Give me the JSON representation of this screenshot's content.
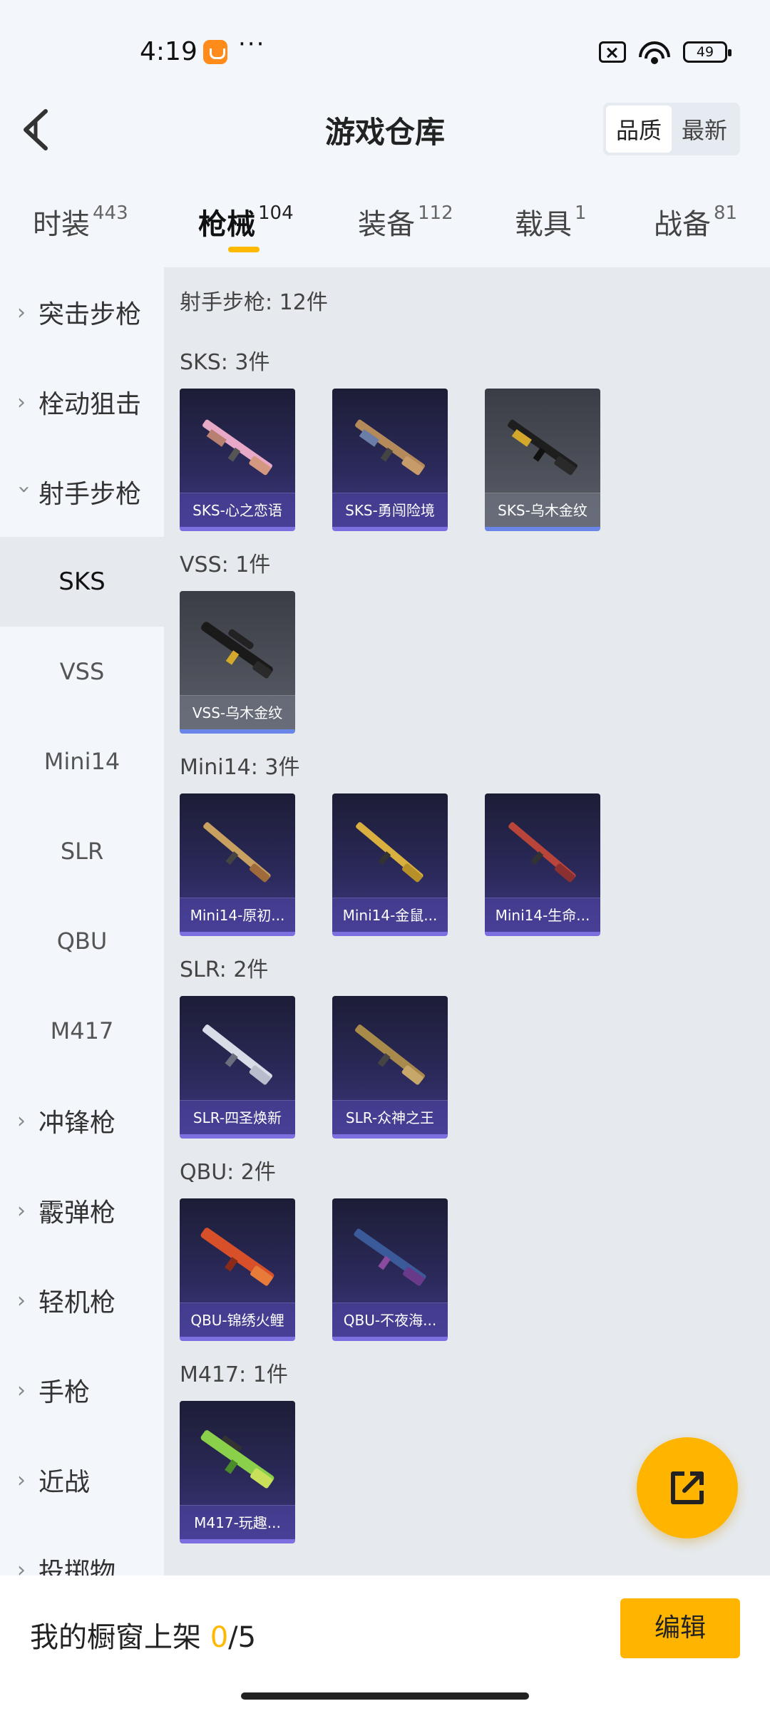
{
  "status_bar": {
    "time": "4:19",
    "dots": "···",
    "battery": "49"
  },
  "header": {
    "title": "游戏仓库",
    "sort_options": [
      "品质",
      "最新"
    ]
  },
  "tabs": [
    {
      "label": "时装",
      "count": "443"
    },
    {
      "label": "枪械",
      "count": "104"
    },
    {
      "label": "装备",
      "count": "112"
    },
    {
      "label": "载具",
      "count": "1"
    },
    {
      "label": "战备",
      "count": "81"
    }
  ],
  "sidebar": {
    "items": [
      {
        "label": "突击步枪",
        "expanded": false
      },
      {
        "label": "栓动狙击",
        "expanded": false
      },
      {
        "label": "射手步枪",
        "expanded": true
      },
      {
        "label": "SKS"
      },
      {
        "label": "VSS"
      },
      {
        "label": "Mini14"
      },
      {
        "label": "SLR"
      },
      {
        "label": "QBU"
      },
      {
        "label": "M417"
      },
      {
        "label": "冲锋枪",
        "expanded": false
      },
      {
        "label": "霰弹枪",
        "expanded": false
      },
      {
        "label": "轻机枪",
        "expanded": false
      },
      {
        "label": "手枪",
        "expanded": false
      },
      {
        "label": "近战",
        "expanded": false
      },
      {
        "label": "投掷物",
        "expanded": false
      }
    ]
  },
  "content": {
    "category_title": "射手步枪: 12件",
    "groups": [
      {
        "heading": "SKS: 3件",
        "items": [
          "SKS-心之恋语",
          "SKS-勇闯险境",
          "SKS-乌木金纹"
        ]
      },
      {
        "heading": "VSS: 1件",
        "items": [
          "VSS-乌木金纹"
        ]
      },
      {
        "heading": "Mini14: 3件",
        "items": [
          "Mini14-原初...",
          "Mini14-金鼠...",
          "Mini14-生命..."
        ]
      },
      {
        "heading": "SLR: 2件",
        "items": [
          "SLR-四圣焕新",
          "SLR-众神之王"
        ]
      },
      {
        "heading": "QBU: 2件",
        "items": [
          "QBU-锦绣火鲤",
          "QBU-不夜海..."
        ]
      },
      {
        "heading": "M417: 1件",
        "items": [
          "M417-玩趣..."
        ]
      }
    ]
  },
  "bottom_bar": {
    "showcase_prefix": "我的橱窗上架 ",
    "showcase_count": "0",
    "showcase_total": "/5",
    "edit_label": "编辑"
  },
  "colors": {
    "accent": "#ffb400",
    "card_border": "#7c6fe0",
    "gray_card_border": "#6a86e8"
  }
}
